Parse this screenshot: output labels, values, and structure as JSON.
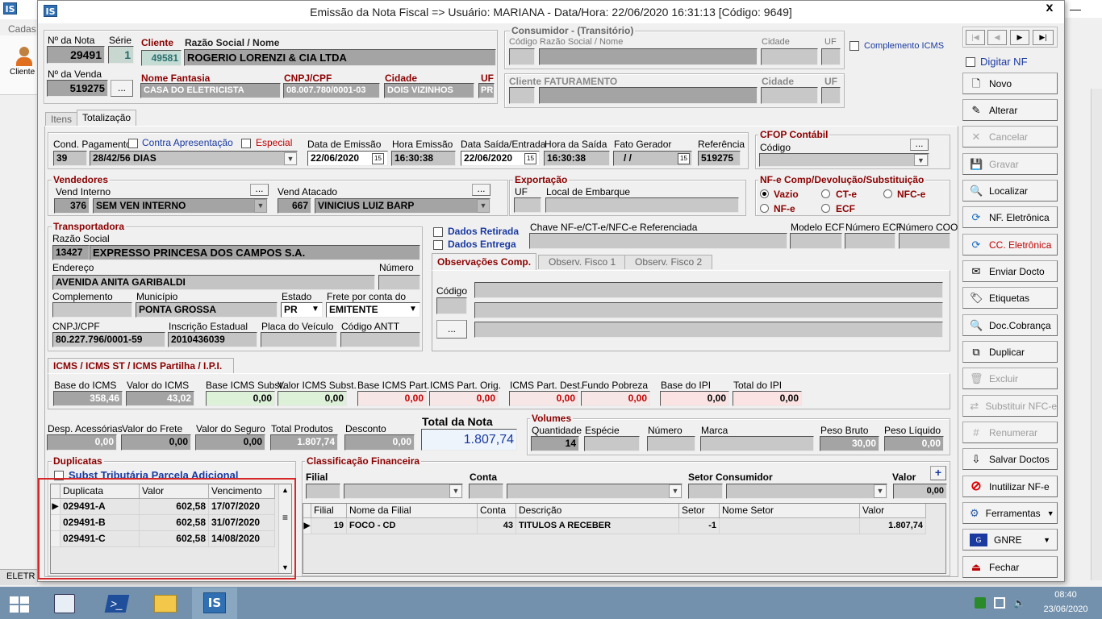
{
  "bg": {
    "app_icon": "IS",
    "menu_label": "Cadas",
    "cliente_label": "Cliente",
    "status_label": "ELETR"
  },
  "window": {
    "title": "Emissão da Nota Fiscal => Usuário: MARIANA - Data/Hora: 22/06/2020 16:31:13 [Código: 9649]",
    "icon": "IS",
    "close": "x"
  },
  "header": {
    "nota_label": "Nº da Nota",
    "nota": "29491",
    "serie_label": "Série",
    "serie": "1",
    "venda_label": "Nº da Venda",
    "venda": "519275",
    "venda_btn": "...",
    "cliente_label": "Cliente",
    "cliente": "49581",
    "razao_label": "Razão Social / Nome",
    "razao": "ROGERIO LORENZI & CIA LTDA",
    "fantasia_label": "Nome Fantasia",
    "fantasia": "CASA DO ELETRICISTA",
    "cnpj_label": "CNPJ/CPF",
    "cnpj": "08.007.780/0001-03",
    "cidade_label": "Cidade",
    "cidade": "DOIS VIZINHOS",
    "uf_label": "UF",
    "uf": "PR"
  },
  "consumidor": {
    "title": "Consumidor - (Transitório)",
    "codigo": "Código",
    "razao": "Razão Social / Nome",
    "cidade": "Cidade",
    "uf": "UF",
    "complemento": "Complemento ICMS"
  },
  "faturamento": {
    "title": "Cliente FATURAMENTO",
    "cidade": "Cidade",
    "uf": "UF"
  },
  "tabs": {
    "itens": "Itens",
    "totalizacao": "Totalização"
  },
  "pagamento": {
    "cond_label": "Cond. Pagamento",
    "contra_label": "Contra Apresentação",
    "especial_label": "Especial",
    "cond_code": "39",
    "cond_desc": "28/42/56 DIAS",
    "emissao_label": "Data de Emissão",
    "emissao": "22/06/2020",
    "hora_emissao_label": "Hora Emissão",
    "hora_emissao": "16:30:38",
    "saida_label": "Data Saída/Entrada",
    "saida": "22/06/2020",
    "hora_saida_label": "Hora da Saída",
    "hora_saida": "16:30:38",
    "fato_label": "Fato Gerador",
    "fato": "/ /",
    "ref_label": "Referência",
    "ref": "519275"
  },
  "cfop": {
    "title": "CFOP Contábil",
    "codigo_label": "Código",
    "btn": "..."
  },
  "vendedores": {
    "title": "Vendedores",
    "interno_label": "Vend Interno",
    "interno_code": "376",
    "interno": "SEM VEN INTERNO",
    "atacado_label": "Vend Atacado",
    "atacado_code": "667",
    "atacado": "VINICIUS LUIZ BARP",
    "btn": "..."
  },
  "exportacao": {
    "title": "Exportação",
    "uf_label": "UF",
    "local_label": "Local de Embarque"
  },
  "nfe_comp": {
    "title": "NF-e Comp/Devolução/Substituição",
    "vazio": "Vazio",
    "cte": "CT-e",
    "nfce": "NFC-e",
    "nfe": "NF-e",
    "ecf": "ECF"
  },
  "transportadora": {
    "title": "Transportadora",
    "razao_label": "Razão Social",
    "codigo": "13427",
    "razao": "EXPRESSO PRINCESA DOS CAMPOS S.A.",
    "endereco_label": "Endereço",
    "numero_label": "Número",
    "endereco": "AVENIDA ANITA GARIBALDI",
    "complemento_label": "Complemento",
    "municipio_label": "Município",
    "municipio": "PONTA GROSSA",
    "estado_label": "Estado",
    "estado": "PR",
    "frete_label": "Frete por conta do",
    "frete": "EMITENTE",
    "cnpj_label": "CNPJ/CPF",
    "cnpj": "80.227.796/0001-59",
    "ie_label": "Inscrição Estadual",
    "ie": "2010436039",
    "placa_label": "Placa do Veículo",
    "antt_label": "Código ANTT"
  },
  "dados": {
    "retirada": "Dados Retirada",
    "entrega": "Dados Entrega",
    "chave_label": "Chave NF-e/CT-e/NFC-e Referenciada",
    "modelo_label": "Modelo ECF",
    "numero_ecf_label": "Número ECF",
    "numero_coo_label": "Número COO"
  },
  "obs": {
    "tab1": "Observações Comp.",
    "tab2": "Observ. Fisco 1",
    "tab3": "Observ. Fisco 2",
    "codigo_label": "Código",
    "btn": "..."
  },
  "icms": {
    "tab": "ICMS / ICMS ST / ICMS Partilha / I.P.I.",
    "base_label": "Base do ICMS",
    "base": "358,46",
    "valor_label": "Valor do ICMS",
    "valor": "43,02",
    "base_st_label": "Base ICMS Subst.",
    "base_st": "0,00",
    "valor_st_label": "Valor ICMS Subst.",
    "valor_st": "0,00",
    "base_part_label": "Base ICMS Part.",
    "base_part": "0,00",
    "orig_label": "ICMS Part. Orig.",
    "orig": "0,00",
    "dest_label": "ICMS Part. Dest.",
    "dest": "0,00",
    "fundo_label": "Fundo Pobreza",
    "fundo": "0,00",
    "base_ipi_label": "Base do IPI",
    "base_ipi": "0,00",
    "total_ipi_label": "Total do IPI",
    "total_ipi": "0,00"
  },
  "totais": {
    "desp_label": "Desp. Acessórias",
    "desp": "0,00",
    "frete_label": "Valor do Frete",
    "frete": "0,00",
    "seguro_label": "Valor do Seguro",
    "seguro": "0,00",
    "produtos_label": "Total Produtos",
    "produtos": "1.807,74",
    "desconto_label": "Desconto",
    "desconto": "0,00",
    "total_label": "Total da Nota",
    "total": "1.807,74"
  },
  "volumes": {
    "title": "Volumes",
    "qtd_label": "Quantidade",
    "qtd": "14",
    "especie_label": "Espécie",
    "numero_label": "Número",
    "marca_label": "Marca",
    "bruto_label": "Peso Bruto",
    "bruto": "30,00",
    "liquido_label": "Peso Líquido",
    "liquido": "0,00"
  },
  "duplicatas": {
    "title": "Duplicatas",
    "subst_label": "Subst Tributária Parcela Adicional",
    "headers": [
      "Duplicata",
      "Valor",
      "Vencimento"
    ],
    "rows": [
      [
        "029491-A",
        "602,58",
        "17/07/2020"
      ],
      [
        "029491-B",
        "602,58",
        "31/07/2020"
      ],
      [
        "029491-C",
        "602,58",
        "14/08/2020"
      ]
    ]
  },
  "classificacao": {
    "title": "Classificação Financeira",
    "filial_label": "Filial",
    "conta_label": "Conta",
    "setor_label": "Setor Consumidor",
    "valor_label": "Valor",
    "valor": "0,00",
    "add": "+",
    "headers": [
      "Filial",
      "Nome da Filial",
      "Conta",
      "Descrição",
      "Setor",
      "Nome Setor",
      "Valor"
    ],
    "rows": [
      [
        "19",
        "FOCO - CD",
        "43",
        "TITULOS A RECEBER",
        "-1",
        "",
        "1.807,74"
      ]
    ]
  },
  "nav": {
    "first": "|◀",
    "prev": "◀",
    "next": "▶",
    "last": "▶|",
    "digitar": "Digitar NF"
  },
  "buttons": [
    {
      "label": "Novo",
      "icon": "new-document-icon",
      "glyph": "🗋",
      "enabled": true
    },
    {
      "label": "Alterar",
      "icon": "edit-icon",
      "glyph": "✎",
      "enabled": true
    },
    {
      "label": "Cancelar",
      "icon": "cancel-icon",
      "glyph": "✕",
      "enabled": false
    },
    {
      "label": "Gravar",
      "icon": "save-icon",
      "glyph": "💾",
      "enabled": false
    },
    {
      "label": "Localizar",
      "icon": "search-icon",
      "glyph": "🔍",
      "enabled": true
    },
    {
      "label": "NF. Eletrônica",
      "icon": "nfe-icon",
      "glyph": "⟳",
      "enabled": true
    },
    {
      "label": "CC. Eletrônica",
      "icon": "cce-icon",
      "glyph": "⟳",
      "enabled": true,
      "color": "#c00000"
    },
    {
      "label": "Enviar Docto",
      "icon": "envelope-icon",
      "glyph": "✉",
      "enabled": true
    },
    {
      "label": "Etiquetas",
      "icon": "labels-icon",
      "glyph": "🏷",
      "enabled": true
    },
    {
      "label": "Doc.Cobrança",
      "icon": "search-doc-icon",
      "glyph": "🔍",
      "enabled": true
    },
    {
      "label": "Duplicar",
      "icon": "copy-icon",
      "glyph": "⧉",
      "enabled": true
    },
    {
      "label": "Excluir",
      "icon": "trash-icon",
      "glyph": "🗑",
      "enabled": false
    },
    {
      "label": "Substituir NFC-e",
      "icon": "replace-icon",
      "glyph": "⇄",
      "enabled": false
    },
    {
      "label": "Renumerar",
      "icon": "renumber-icon",
      "glyph": "#",
      "enabled": false
    },
    {
      "label": "Salvar Doctos",
      "icon": "save-docs-icon",
      "glyph": "⇩",
      "enabled": true
    },
    {
      "label": "Inutilizar NF-e",
      "icon": "forbidden-icon",
      "glyph": "⊘",
      "enabled": true
    },
    {
      "label": "Ferramentas",
      "icon": "gears-icon",
      "glyph": "⚙",
      "enabled": true
    },
    {
      "label": "GNRE",
      "icon": "gnre-icon",
      "glyph": "G",
      "enabled": true
    },
    {
      "label": "Fechar",
      "icon": "exit-icon",
      "glyph": "⏏",
      "enabled": true
    }
  ],
  "taskbar": {
    "time": "08:40",
    "date": "23/06/2020"
  }
}
